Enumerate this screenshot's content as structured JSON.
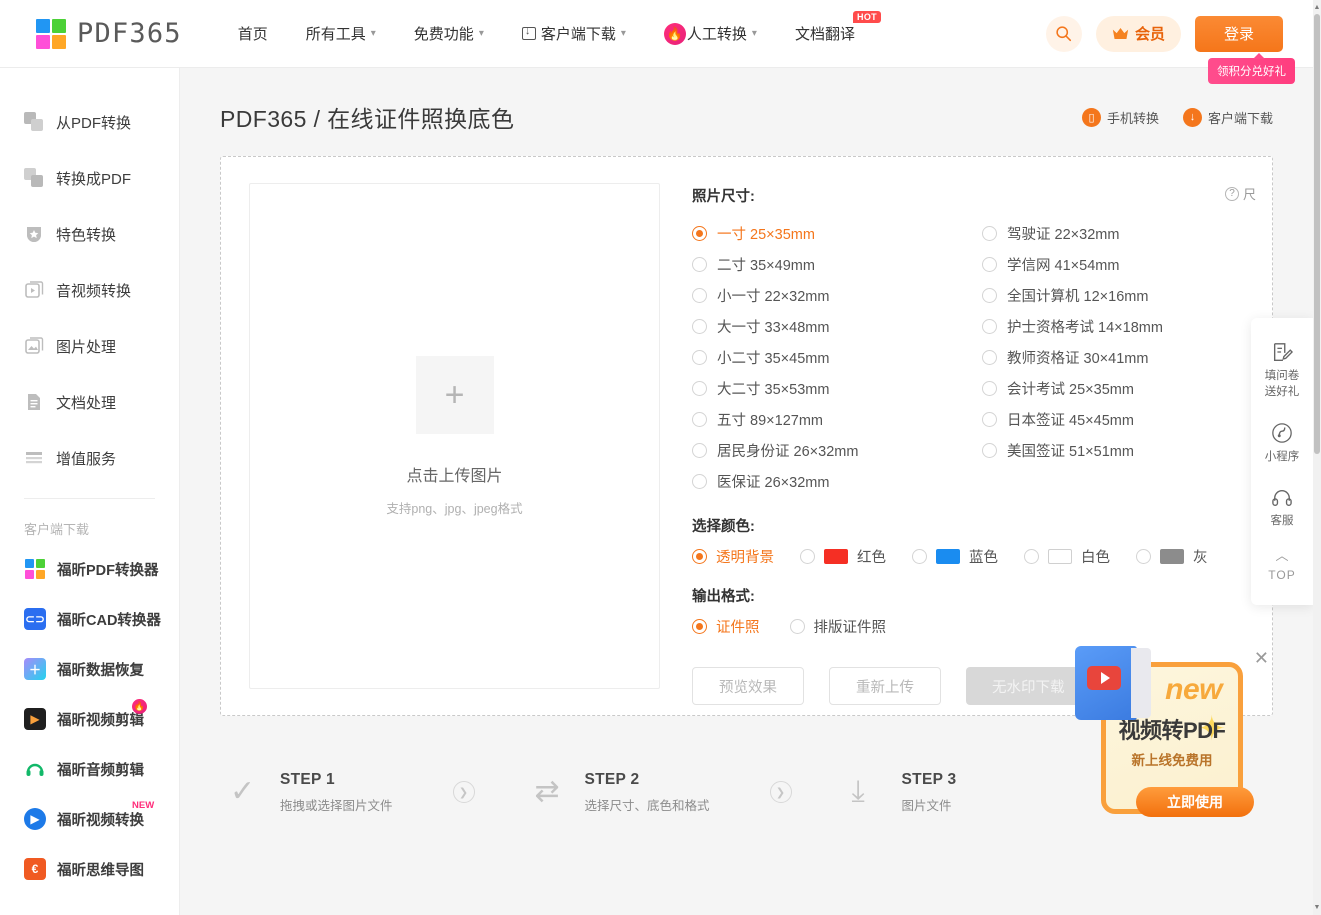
{
  "header": {
    "logo_text": "PDF365",
    "logo_colors": [
      "#2196f3",
      "#4cd137",
      "#ff4fd8",
      "#ffa726"
    ],
    "nav": [
      {
        "label": "首页",
        "caret": false,
        "icon": "",
        "badge": ""
      },
      {
        "label": "所有工具",
        "caret": true,
        "icon": "",
        "badge": ""
      },
      {
        "label": "免费功能",
        "caret": true,
        "icon": "",
        "badge": ""
      },
      {
        "label": "客户端下载",
        "caret": true,
        "icon": "download-box-icon",
        "badge": ""
      },
      {
        "label": "人工转换",
        "caret": true,
        "icon": "fire-icon",
        "badge": ""
      },
      {
        "label": "文档翻译",
        "caret": false,
        "icon": "",
        "badge": "HOT"
      }
    ],
    "search_icon": "search-icon",
    "vip_label": "会员",
    "vip_icon": "crown-icon",
    "login_label": "登录",
    "login_tip": "领积分兑好礼",
    "accent": "#f4761c"
  },
  "sidebar": {
    "items": [
      {
        "label": "从PDF转换",
        "icon": "pdf-from-icon"
      },
      {
        "label": "转换成PDF",
        "icon": "pdf-to-icon"
      },
      {
        "label": "特色转换",
        "icon": "shield-star-icon"
      },
      {
        "label": "音视频转换",
        "icon": "media-icon"
      },
      {
        "label": "图片处理",
        "icon": "image-icon"
      },
      {
        "label": "文档处理",
        "icon": "document-icon"
      },
      {
        "label": "增值服务",
        "icon": "list-icon"
      }
    ],
    "client_section_title": "客户端下载",
    "clients": [
      {
        "label": "福昕PDF转换器",
        "icon": "foxit-grid-icon",
        "color": "#2196f3",
        "badge": ""
      },
      {
        "label": "福昕CAD转换器",
        "icon": "cad-icon",
        "color": "#2b6ef0",
        "badge": ""
      },
      {
        "label": "福昕数据恢复",
        "icon": "data-recovery-icon",
        "color": "#8b5cf6",
        "badge": ""
      },
      {
        "label": "福昕视频剪辑",
        "icon": "video-edit-icon",
        "color": "#1f1f1f",
        "badge": "FIRE"
      },
      {
        "label": "福昕音频剪辑",
        "icon": "audio-edit-icon",
        "color": "#ffffff",
        "badge": ""
      },
      {
        "label": "福昕视频转换",
        "icon": "video-convert-icon",
        "color": "#1d7ae8",
        "badge": "NEW"
      },
      {
        "label": "福昕思维导图",
        "icon": "mindmap-icon",
        "color": "#f05a22",
        "badge": ""
      }
    ]
  },
  "page": {
    "title": "PDF365 / 在线证件照换底色",
    "head_actions": [
      {
        "label": "手机转换",
        "icon": "phone-icon"
      },
      {
        "label": "客户端下载",
        "icon": "download-icon"
      }
    ]
  },
  "upload": {
    "plus": "+",
    "title": "点击上传图片",
    "subtitle": "支持png、jpg、jpeg格式"
  },
  "options": {
    "size_label": "照片尺寸:",
    "size_help": "尺",
    "size_help_icon": "question-icon",
    "sizes_left": [
      {
        "label": "一寸 25×35mm",
        "selected": true
      },
      {
        "label": "二寸 35×49mm",
        "selected": false
      },
      {
        "label": "小一寸 22×32mm",
        "selected": false
      },
      {
        "label": "大一寸 33×48mm",
        "selected": false
      },
      {
        "label": "小二寸 35×45mm",
        "selected": false
      },
      {
        "label": "大二寸 35×53mm",
        "selected": false
      },
      {
        "label": "五寸 89×127mm",
        "selected": false
      },
      {
        "label": "居民身份证 26×32mm",
        "selected": false
      },
      {
        "label": "医保证 26×32mm",
        "selected": false
      }
    ],
    "sizes_right": [
      {
        "label": "驾驶证 22×32mm",
        "selected": false
      },
      {
        "label": "学信网 41×54mm",
        "selected": false
      },
      {
        "label": "全国计算机 12×16mm",
        "selected": false
      },
      {
        "label": "护士资格考试 14×18mm",
        "selected": false
      },
      {
        "label": "教师资格证 30×41mm",
        "selected": false
      },
      {
        "label": "会计考试 25×35mm",
        "selected": false
      },
      {
        "label": "日本签证 45×45mm",
        "selected": false
      },
      {
        "label": "美国签证 51×51mm",
        "selected": false
      }
    ],
    "color_label": "选择颜色:",
    "colors": [
      {
        "label": "透明背景",
        "swatch": "",
        "selected": true
      },
      {
        "label": "红色",
        "swatch": "#f52f24",
        "selected": false
      },
      {
        "label": "蓝色",
        "swatch": "#1a8cf0",
        "selected": false
      },
      {
        "label": "白色",
        "swatch": "#ffffff",
        "selected": false
      },
      {
        "label": "灰",
        "swatch": "#8c8c8c",
        "selected": false
      }
    ],
    "format_label": "输出格式:",
    "formats": [
      {
        "label": "证件照",
        "selected": true
      },
      {
        "label": "排版证件照",
        "selected": false
      }
    ],
    "buttons": [
      {
        "label": "预览效果",
        "style": "outline"
      },
      {
        "label": "重新上传",
        "style": "outline"
      },
      {
        "label": "无水印下载",
        "style": "filled"
      }
    ]
  },
  "steps": [
    {
      "num": "STEP 1",
      "desc": "拖拽或选择图片文件",
      "icon": "check-icon"
    },
    {
      "num": "STEP 2",
      "desc": "选择尺寸、底色和格式",
      "icon": "swap-icon"
    },
    {
      "num": "STEP 3",
      "desc": "图片文件",
      "icon": "download-arrow-icon"
    }
  ],
  "step_arrow": "❯",
  "float_bar": [
    {
      "label": "填问卷\n送好礼",
      "icon": "survey-icon"
    },
    {
      "label": "小程序",
      "icon": "miniprogram-icon"
    },
    {
      "label": "客服",
      "icon": "headset-icon"
    },
    {
      "label": "TOP",
      "icon": "arrow-up-icon"
    }
  ],
  "ad": {
    "new_text": "new",
    "title": "视频转PDF",
    "subtitle": "新上线免费用",
    "button": "立即使用",
    "close_icon": "close-icon"
  }
}
